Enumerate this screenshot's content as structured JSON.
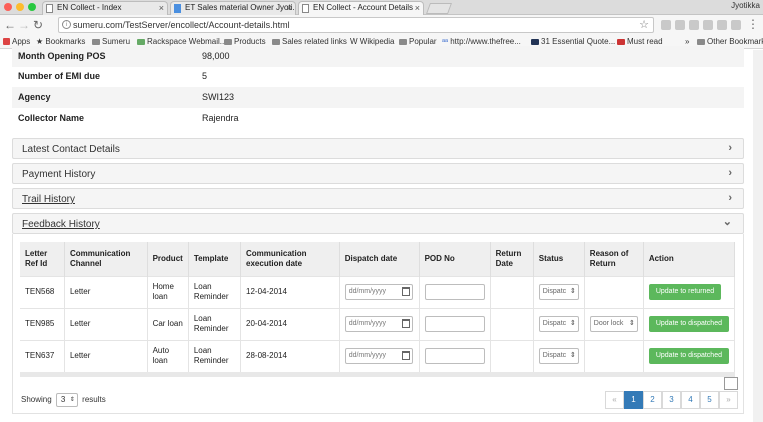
{
  "browser": {
    "tabs": [
      {
        "title": "EN Collect - Index"
      },
      {
        "title": "ET Sales material Owner Jyoti..."
      },
      {
        "title": "EN Collect - Account Details"
      }
    ],
    "user": "Jyotikka",
    "url": "sumeru.com/TestServer/encollect/Account-details.html",
    "bookmarks": [
      "Apps",
      "Bookmarks",
      "Sumeru",
      "Rackspace Webmail...",
      "Products",
      "Sales related links",
      "Wikipedia",
      "Popular",
      "http://www.thefree...",
      "31 Essential Quote...",
      "Must read",
      "»",
      "Other Bookmarks"
    ]
  },
  "account_info": [
    {
      "label": "Month Opening POS",
      "value": "98,000"
    },
    {
      "label": "Number of EMI due",
      "value": "5"
    },
    {
      "label": "Agency",
      "value": "SWI123"
    },
    {
      "label": "Collector Name",
      "value": "Rajendra"
    }
  ],
  "sections": {
    "latest_contact": "Latest Contact Details",
    "payment_history": "Payment History",
    "trail_history": "Trail History",
    "feedback_history": "Feedback History"
  },
  "table": {
    "headers": [
      "Letter Ref Id",
      "Communication Channel",
      "Product",
      "Template",
      "Communication execution date",
      "Dispatch date",
      "POD No",
      "Return Date",
      "Status",
      "Reason of Return",
      "Action"
    ],
    "date_placeholder": "dd/mm/yyyy",
    "rows": [
      {
        "ref": "TEN568",
        "channel": "Letter",
        "product": "Home loan",
        "template": "Loan Reminder",
        "exec_date": "12-04-2014",
        "status": "Dispatc",
        "reason": "",
        "action": "Update to returned"
      },
      {
        "ref": "TEN985",
        "channel": "Letter",
        "product": "Car loan",
        "template": "Loan Reminder",
        "exec_date": "20-04-2014",
        "status": "Dispatc",
        "reason": "Door lock",
        "action": "Update to dispatched"
      },
      {
        "ref": "TEN637",
        "channel": "Letter",
        "product": "Auto loan",
        "template": "Loan Reminder",
        "exec_date": "28-08-2014",
        "status": "Dispatc",
        "reason": "",
        "action": "Update to dispatched"
      }
    ]
  },
  "footer": {
    "showing_prefix": "Showing",
    "page_size": "3",
    "showing_suffix": "results",
    "pages": [
      "«",
      "1",
      "2",
      "3",
      "4",
      "5",
      "»"
    ]
  },
  "colors": {
    "action_button": "#5cb85c",
    "pager_active": "#337ab7"
  }
}
